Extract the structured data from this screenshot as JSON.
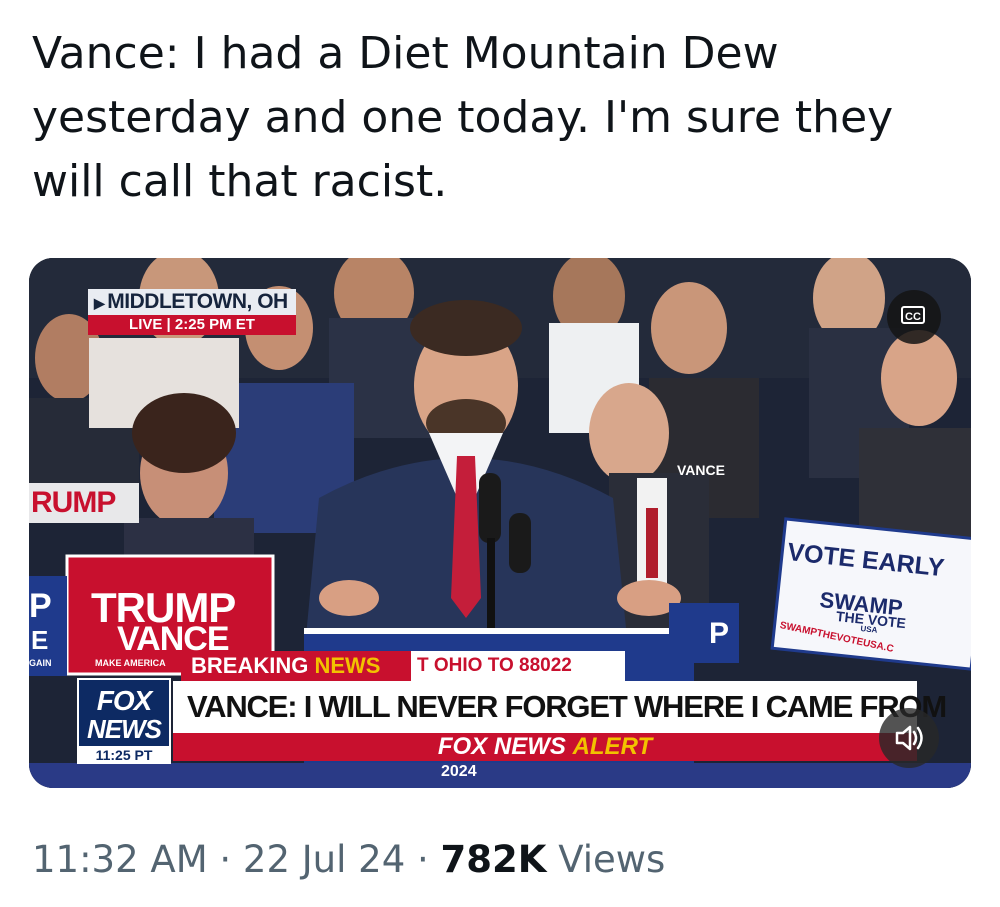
{
  "tweet": {
    "text": "Vance: I had a Diet Mountain Dew yesterday and one today. I'm sure they will call that racist."
  },
  "video": {
    "location": "MIDDLETOWN, OH",
    "live_label": "LIVE | 2:25 PM ET",
    "cc_label": "CC",
    "breaking_prefix": "BREAKING",
    "breaking_news": "NEWS",
    "ticker_text": "T OHIO TO 88022",
    "network_line1": "FOX",
    "network_line2": "NEWS",
    "network_time": "11:25 PT",
    "headline": "VANCE: I WILL NEVER FORGET WHERE I CAME FROM",
    "alert_prefix": "FOX NEWS",
    "alert_word": "ALERT",
    "signs": {
      "trump": "TRUMP",
      "vance": "VANCE",
      "make_america": "MAKE AMERICA",
      "vote_early": "VOTE EARLY",
      "swamp": "SWAMP",
      "the_vote": "THE VOTE",
      "usa": "USA",
      "swamp_url": "SWAMPTHEVOTEUSA.C",
      "rump": "RUMP",
      "year": "2024",
      "p_left": "P",
      "e_left": "E",
      "gain": "GAIN",
      "p_right": "P",
      "shirt_vance": "VANCE"
    },
    "speaker_icon": "speaker-volume-icon"
  },
  "meta": {
    "time": "11:32 AM",
    "sep1": " · ",
    "date": "22 Jul 24",
    "sep2": " · ",
    "views_count": "782K",
    "views_label": " Views"
  }
}
